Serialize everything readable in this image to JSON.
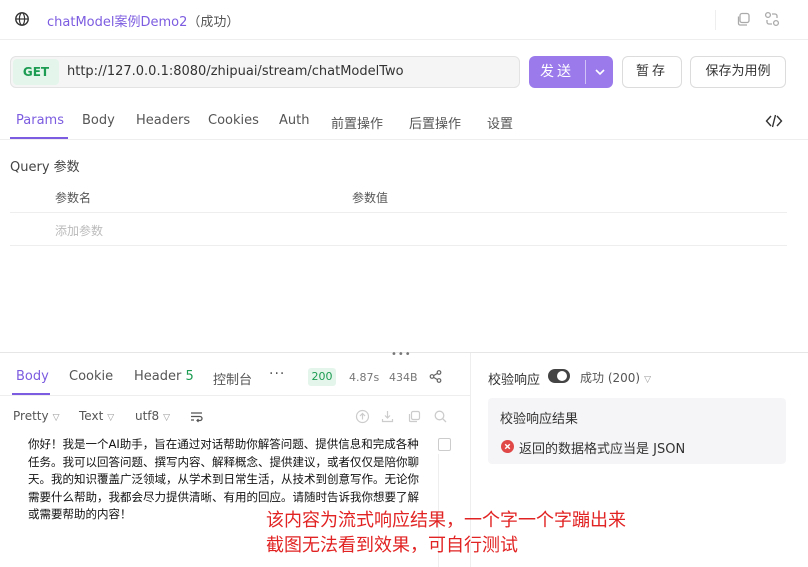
{
  "title": {
    "name": "chatModel案例Demo2",
    "status": "（成功）"
  },
  "request": {
    "method": "GET",
    "url": "http://127.0.0.1:8080/zhipuai/stream/chatModelTwo",
    "send_label": "发送",
    "pause_label": "暂存",
    "save_example_label": "保存为用例"
  },
  "request_tabs": [
    "Params",
    "Body",
    "Headers",
    "Cookies",
    "Auth",
    "前置操作",
    "后置操作",
    "设置"
  ],
  "query": {
    "title": "Query 参数",
    "col_name": "参数名",
    "col_value": "参数值",
    "add_placeholder": "添加参数"
  },
  "response_tabs": {
    "body": "Body",
    "cookie": "Cookie",
    "header": "Header",
    "header_count": "5",
    "console": "控制台",
    "more": "···"
  },
  "response_meta": {
    "status": "200",
    "time": "4.87s",
    "size": "434B"
  },
  "toolbar": {
    "format": "Pretty",
    "type": "Text",
    "encoding": "utf8"
  },
  "response_body": "你好！我是一个AI助手，旨在通过对话帮助你解答问题、提供信息和完成各种任务。我可以回答问题、撰写内容、解释概念、提供建议，或者仅仅是陪你聊天。我的知识覆盖广泛领域，从学术到日常生活，从技术到创意写作。无论你需要什么帮助，我都会尽力提供清晰、有用的回应。请随时告诉我你想要了解或需要帮助的内容！",
  "annotation": [
    "该内容为流式响应结果，一个字一个字蹦出来",
    "截图无法看到效果，可自行测试"
  ],
  "validation": {
    "label": "校验响应",
    "toggle_on": true,
    "result_select": "成功 (200)",
    "card_title": "校验响应结果",
    "error_text": "返回的数据格式应当是 JSON"
  },
  "colors": {
    "accent": "#7c5ce0",
    "send": "#9b7bec",
    "success": "#1c9b52",
    "error": "#e04848",
    "annotation": "#e22323"
  },
  "icons": [
    "globe-icon",
    "copy-icon",
    "transform-icon",
    "chevron-down-icon",
    "code-icon",
    "share-icon",
    "wrap-icon",
    "upload-icon",
    "download-icon",
    "copy-icon",
    "search-icon",
    "error-icon"
  ]
}
